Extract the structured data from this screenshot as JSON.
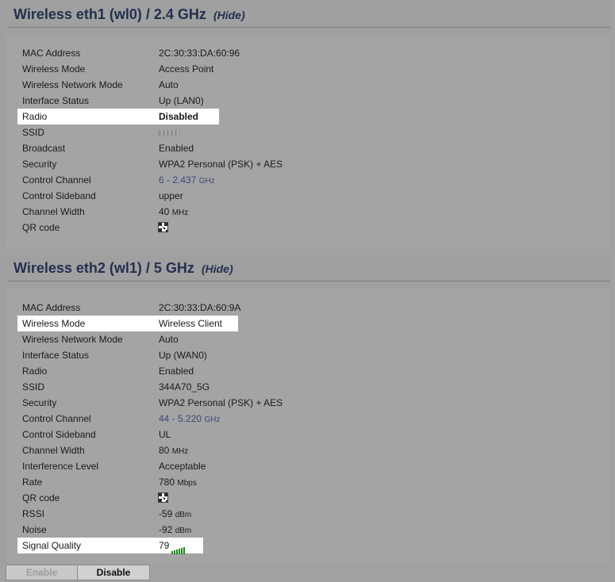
{
  "wl0": {
    "title": "Wireless eth1 (wl0) / 2.4 GHz",
    "hide_label": "(Hide)",
    "rows": {
      "mac": {
        "label": "MAC Address",
        "value": "2C:30:33:DA:60:96"
      },
      "mode": {
        "label": "Wireless Mode",
        "value": "Access Point"
      },
      "netmode": {
        "label": "Wireless Network Mode",
        "value": "Auto"
      },
      "ifstatus": {
        "label": "Interface Status",
        "value": "Up (LAN0)"
      },
      "radio": {
        "label": "Radio",
        "value": "Disabled"
      },
      "ssid": {
        "label": "SSID",
        "value": ""
      },
      "broadcast": {
        "label": "Broadcast",
        "value": "Enabled"
      },
      "security": {
        "label": "Security",
        "value": "WPA2 Personal (PSK) + AES"
      },
      "channel": {
        "label": "Control Channel",
        "value": "6 - 2.437",
        "unit": "GHz"
      },
      "sideband": {
        "label": "Control Sideband",
        "value": "upper"
      },
      "width": {
        "label": "Channel Width",
        "value": "40",
        "unit": "MHz"
      },
      "qr": {
        "label": "QR code",
        "icon": "qr-code-icon"
      }
    }
  },
  "wl1": {
    "title": "Wireless eth2 (wl1) / 5 GHz",
    "hide_label": "(Hide)",
    "rows": {
      "mac": {
        "label": "MAC Address",
        "value": "2C:30:33:DA:60:9A"
      },
      "mode": {
        "label": "Wireless Mode",
        "value": "Wireless Client"
      },
      "netmode": {
        "label": "Wireless Network Mode",
        "value": "Auto"
      },
      "ifstatus": {
        "label": "Interface Status",
        "value": "Up (WAN0)"
      },
      "radio": {
        "label": "Radio",
        "value": "Enabled"
      },
      "ssid": {
        "label": "SSID",
        "value": "344A70_5G"
      },
      "security": {
        "label": "Security",
        "value": "WPA2 Personal (PSK) + AES"
      },
      "channel": {
        "label": "Control Channel",
        "value": "44 - 5.220",
        "unit": "GHz"
      },
      "sideband": {
        "label": "Control Sideband",
        "value": "UL"
      },
      "width": {
        "label": "Channel Width",
        "value": "80",
        "unit": "MHz"
      },
      "interference": {
        "label": "Interference Level",
        "value": "Acceptable"
      },
      "rate": {
        "label": "Rate",
        "value": "780",
        "unit": "Mbps"
      },
      "qr": {
        "label": "QR code",
        "icon": "qr-code-icon"
      },
      "rssi": {
        "label": "RSSI",
        "value": "-59",
        "unit": "dBm"
      },
      "noise": {
        "label": "Noise",
        "value": "-92",
        "unit": "dBm"
      },
      "quality": {
        "label": "Signal Quality",
        "value": "79",
        "icon": "signal-bars-icon"
      }
    }
  },
  "buttons": {
    "enable": "Enable",
    "disable": "Disable"
  },
  "colors": {
    "title": "#23304f",
    "channel_link": "#3b4a7a",
    "signal_bars": "#1a8c1a",
    "highlight": "#ffffff"
  }
}
